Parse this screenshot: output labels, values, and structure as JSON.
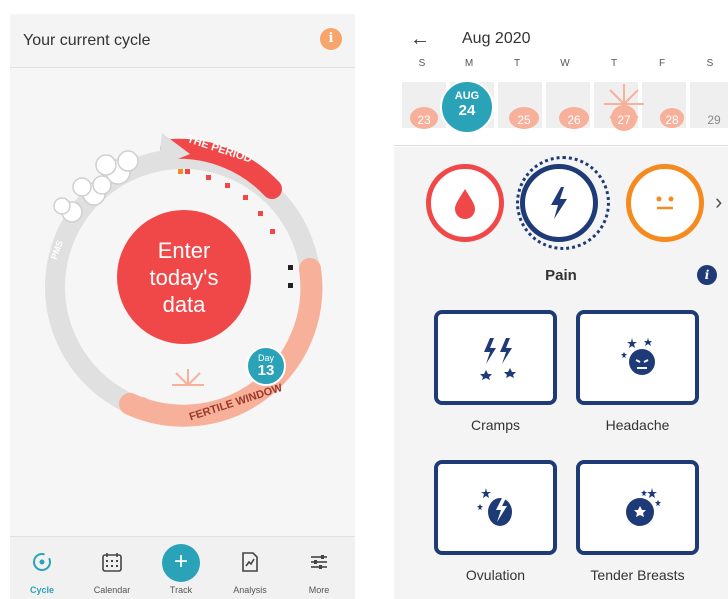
{
  "left": {
    "header_title": "Your current cycle",
    "info_glyph": "i",
    "period_label": "THE PERIOD",
    "pms_label": "PMS",
    "fertile_label": "FERTILE WINDOW",
    "enter_line1": "Enter",
    "enter_line2": "today's",
    "enter_line3": "data",
    "day_badge_label": "Day",
    "day_badge_value": "13",
    "nav": [
      {
        "label": "Cycle",
        "icon": "cycle-icon",
        "active": true
      },
      {
        "label": "Calendar",
        "icon": "calendar-icon",
        "active": false
      },
      {
        "label": "Track",
        "icon": "plus-icon",
        "active": false
      },
      {
        "label": "Analysis",
        "icon": "analysis-icon",
        "active": false
      },
      {
        "label": "More",
        "icon": "sliders-icon",
        "active": false
      }
    ],
    "track_glyph": "+"
  },
  "right": {
    "back_glyph": "←",
    "month_title": "Aug 2020",
    "weekdays": [
      "S",
      "M",
      "T",
      "W",
      "T",
      "F",
      "S"
    ],
    "days": [
      "23",
      "24",
      "25",
      "26",
      "27",
      "28",
      "29"
    ],
    "selected_month": "AUG",
    "selected_day": "24",
    "categories": [
      "blood-drop-icon",
      "lightning-bolt-icon",
      "smiley-face-icon"
    ],
    "more_glyph": "›",
    "section_title": "Pain",
    "info_glyph": "i",
    "options": [
      {
        "label": "Cramps",
        "icon": "cramps-icon"
      },
      {
        "label": "Headache",
        "icon": "headache-icon"
      },
      {
        "label": "Ovulation",
        "icon": "ovulation-icon"
      },
      {
        "label": "Tender Breasts",
        "icon": "tender-breasts-icon"
      }
    ]
  },
  "colors": {
    "accent_teal": "#2aa3b8",
    "period_red": "#f04848",
    "fertile_peach": "#f7b09a",
    "pain_navy": "#1e3b78",
    "mood_orange": "#f58a1f"
  }
}
